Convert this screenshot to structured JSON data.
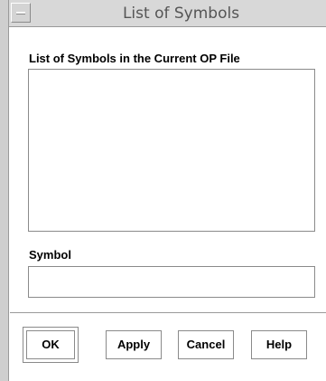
{
  "window": {
    "title": "List of Symbols"
  },
  "symbols_list": {
    "label": "List of Symbols in the Current OP File",
    "items": []
  },
  "symbol_field": {
    "label": "Symbol",
    "value": ""
  },
  "buttons": {
    "ok": "OK",
    "apply": "Apply",
    "cancel": "Cancel",
    "help": "Help"
  }
}
